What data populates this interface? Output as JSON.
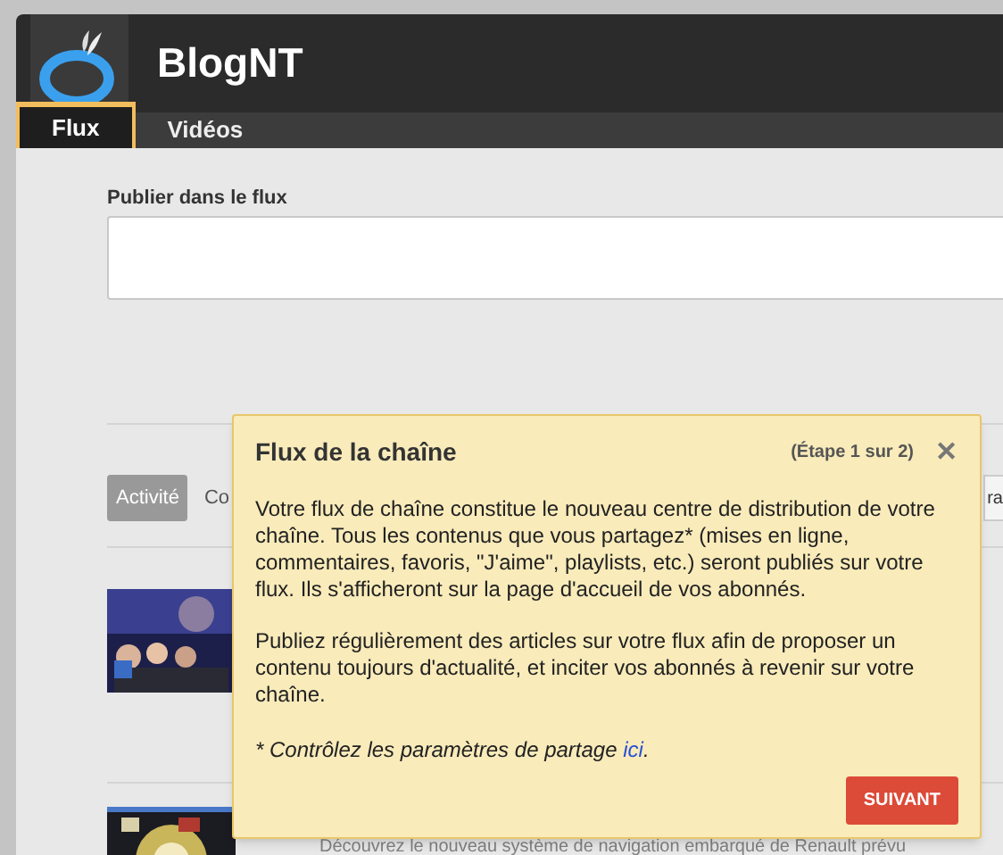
{
  "channel": {
    "name": "BlogNT"
  },
  "tabs": [
    {
      "label": "Flux",
      "selected": true
    },
    {
      "label": "Vidéos",
      "selected": false
    }
  ],
  "publish": {
    "label": "Publier dans le flux"
  },
  "filters": [
    {
      "label": "Activité",
      "selected": true
    },
    {
      "label": "Co",
      "selected": false
    }
  ],
  "right_button": {
    "label": "ra"
  },
  "feed": [
    {
      "kind": "picture"
    },
    {
      "kind": "picture",
      "description": "Découvrez le nouveau système de navigation embarqué de Renault prévu"
    }
  ],
  "popup": {
    "title": "Flux de la chaîne",
    "step": "(Étape 1 sur 2)",
    "close": "✕",
    "paragraphs": [
      "Votre flux de chaîne constitue le nouveau centre de distribution de votre chaîne. Tous les contenus que vous partagez* (mises en ligne, commentaires, favoris, \"J'aime\", playlists, etc.) seront publiés sur votre flux. Ils s'afficheront sur la page d'accueil de vos abonnés.",
      "Publiez régulièrement des articles sur votre flux afin de proposer un contenu toujours d'actualité, et inciter vos abonnés à revenir sur votre chaîne."
    ],
    "note": "* Contrôlez les paramètres de partage ",
    "link": "ici",
    "note_end": ".",
    "button": "SUIVANT"
  }
}
